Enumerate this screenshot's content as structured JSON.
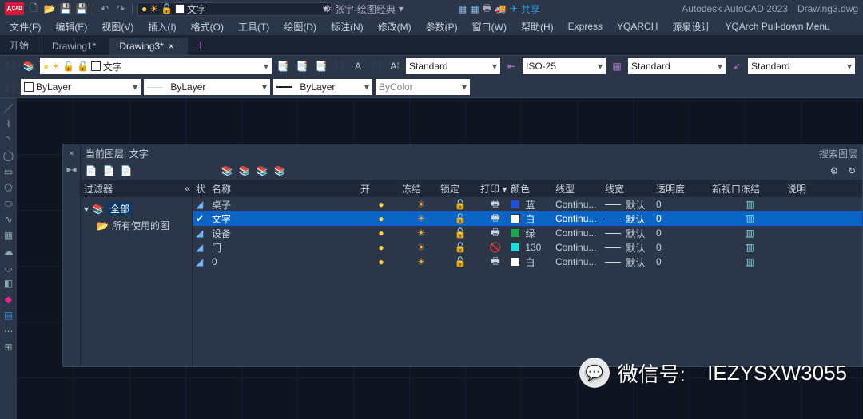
{
  "app": {
    "name": "Autodesk AutoCAD 2023",
    "document": "Drawing3.dwg",
    "logo_text": "A",
    "logo_sup": "CAD"
  },
  "titlebar": {
    "workspace_label": "张宇-绘图经典",
    "share_label": "共享",
    "layer_chip": "文字"
  },
  "menu": {
    "items": [
      "文件(F)",
      "编辑(E)",
      "视图(V)",
      "插入(I)",
      "格式(O)",
      "工具(T)",
      "绘图(D)",
      "标注(N)",
      "修改(M)",
      "参数(P)",
      "窗口(W)",
      "帮助(H)",
      "Express",
      "YQARCH",
      "源泉设计",
      "YQArch Pull-down Menu"
    ]
  },
  "tabs": {
    "start": "开始",
    "items": [
      {
        "label": "Drawing1*",
        "active": false
      },
      {
        "label": "Drawing3*",
        "active": true
      }
    ]
  },
  "ribbon": {
    "layer_combo": "文字",
    "style_text": "Standard",
    "style_dim": "ISO-25",
    "style_table": "Standard",
    "style_ml": "Standard",
    "row2_color": "ByLayer",
    "row2_lt": "ByLayer",
    "row2_lw": "ByLayer",
    "row2_ps": "ByColor"
  },
  "layer_palette": {
    "title_prefix": "当前图层:",
    "current": "文字",
    "search_placeholder": "搜索图层",
    "filter_header": "过滤器",
    "tree_all": "全部",
    "tree_used": "所有使用的图",
    "columns": {
      "status": "状",
      "name": "名称",
      "on": "开",
      "freeze": "冻结",
      "lock": "锁定",
      "plot": "打印",
      "color": "颜色",
      "ltype": "线型",
      "lweight": "线宽",
      "transparency": "透明度",
      "vpfreeze": "新视口冻结",
      "desc": "说明"
    },
    "rows": [
      {
        "name": "桌子",
        "on": true,
        "freeze": false,
        "lock": false,
        "plot": true,
        "color": "蓝",
        "swatch": "sw-blue",
        "ltype": "Continu...",
        "lw": "默认",
        "tr": "0",
        "sel": false
      },
      {
        "name": "文字",
        "on": true,
        "freeze": false,
        "lock": false,
        "plot": true,
        "color": "白",
        "swatch": "sw-white",
        "ltype": "Continu...",
        "lw": "默认",
        "tr": "0",
        "sel": true
      },
      {
        "name": "设备",
        "on": true,
        "freeze": false,
        "lock": false,
        "plot": true,
        "color": "绿",
        "swatch": "sw-green",
        "ltype": "Continu...",
        "lw": "默认",
        "tr": "0",
        "sel": false
      },
      {
        "name": "门",
        "on": true,
        "freeze": false,
        "lock": false,
        "plot": false,
        "color": "130",
        "swatch": "sw-cyan",
        "ltype": "Continu...",
        "lw": "默认",
        "tr": "0",
        "sel": false
      },
      {
        "name": "0",
        "on": true,
        "freeze": false,
        "lock": false,
        "plot": true,
        "color": "白",
        "swatch": "sw-white",
        "ltype": "Continu...",
        "lw": "默认",
        "tr": "0",
        "sel": false
      }
    ]
  },
  "watermark": {
    "label": "微信号:",
    "id": "IEZYSXW3055"
  }
}
